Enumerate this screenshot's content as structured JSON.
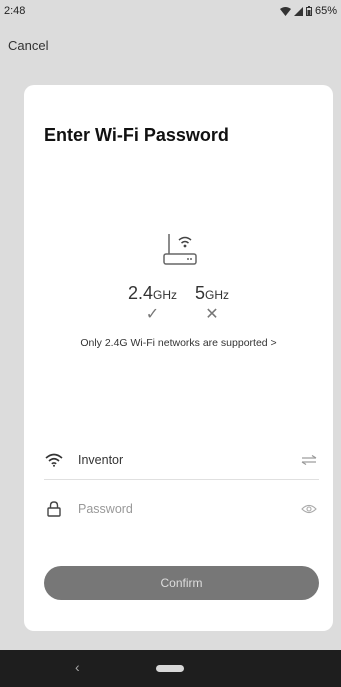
{
  "status_bar": {
    "time": "2:48",
    "battery": "65%",
    "icons": [
      "wifi-icon",
      "signal-icon",
      "battery-icon"
    ]
  },
  "header": {
    "cancel_label": "Cancel"
  },
  "card": {
    "title": "Enter Wi-Fi Password",
    "router_icon": "router-icon",
    "bands": [
      {
        "label": "2.4",
        "unit": "GHz",
        "supported": true,
        "mark": "✓"
      },
      {
        "label": "5",
        "unit": "GHz",
        "supported": false,
        "mark": "✕"
      }
    ],
    "support_link": "Only 2.4G Wi-Fi networks are supported >",
    "ssid_field": {
      "value": "Inventor",
      "left_icon": "wifi-icon",
      "right_icon": "swap-icon"
    },
    "password_field": {
      "placeholder": "Password",
      "value": "",
      "left_icon": "lock-icon",
      "right_icon": "eye-icon"
    },
    "confirm_label": "Confirm"
  },
  "nav_bar": {
    "back_icon": "back-icon",
    "home_icon": "home-pill-icon"
  },
  "colors": {
    "background": "#dcdcdc",
    "card": "#ffffff",
    "button": "#777777",
    "button_text": "#dddddd",
    "nav_bar": "#1e1e1e"
  }
}
